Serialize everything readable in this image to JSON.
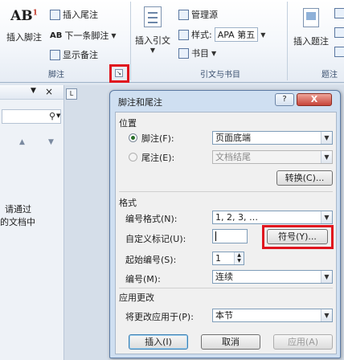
{
  "ribbon": {
    "footnote_group": {
      "insert_footnote": "插入脚注",
      "insert_endnote": "插入尾注",
      "next_footnote": "下一条脚注",
      "show_notes": "显示备注",
      "group_label": "脚注"
    },
    "citations_group": {
      "insert_citation": "插入引文",
      "manage_sources": "管理源",
      "style_label": "样式:",
      "style_value": "APA 第五",
      "bibliography": "书目",
      "group_label": "引文与书目"
    },
    "captions_group": {
      "insert_caption": "插入题注",
      "group_label": "题注"
    }
  },
  "left_pane": {
    "text_line1": "请通过",
    "text_line2": "的文档中"
  },
  "dialog": {
    "title": "脚注和尾注",
    "help": "?",
    "close": "X",
    "location": {
      "heading": "位置",
      "footnote_label": "脚注(F):",
      "footnote_value": "页面底端",
      "endnote_label": "尾注(E):",
      "endnote_value": "文档结尾",
      "convert_button": "转换(C)..."
    },
    "format": {
      "heading": "格式",
      "number_format_label": "编号格式(N):",
      "number_format_value": "1, 2, 3, …",
      "custom_mark_label": "自定义标记(U):",
      "custom_mark_value": "",
      "symbol_button": "符号(Y)...",
      "start_at_label": "起始编号(S):",
      "start_at_value": "1",
      "numbering_label": "编号(M):",
      "numbering_value": "连续"
    },
    "apply": {
      "heading": "应用更改",
      "apply_to_label": "将更改应用于(P):",
      "apply_to_value": "本节"
    },
    "buttons": {
      "insert": "插入(I)",
      "cancel": "取消",
      "apply": "应用(A)"
    }
  },
  "colors": {
    "highlight": "#e0141e",
    "dialog_frame": "#cfdff1",
    "ribbon_label": "#3b5170"
  }
}
